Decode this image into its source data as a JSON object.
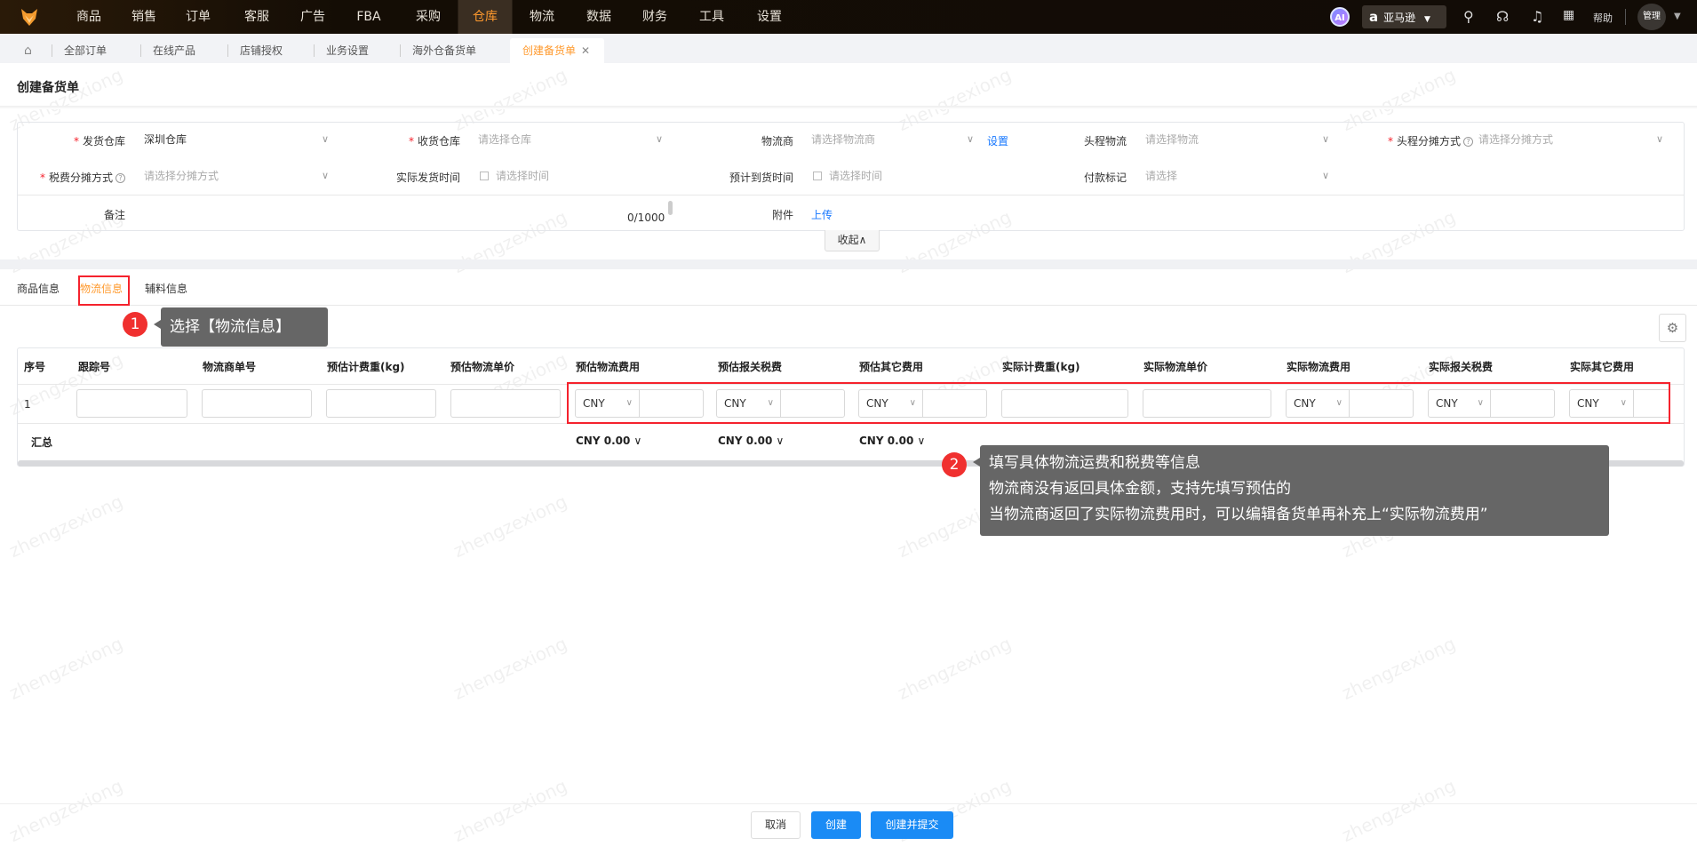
{
  "topnav": {
    "items": [
      "商品",
      "销售",
      "订单",
      "客服",
      "广告",
      "FBA",
      "采购",
      "仓库",
      "物流",
      "数据",
      "财务",
      "工具",
      "设置"
    ],
    "active_index": 7,
    "ai_label": "AI",
    "site_select": "亚马逊",
    "help": "帮助",
    "user": "管理"
  },
  "page_tabs": [
    {
      "label": "全部订单"
    },
    {
      "label": "在线产品"
    },
    {
      "label": "店铺授权"
    },
    {
      "label": "业务设置"
    },
    {
      "label": "海外仓备货单"
    },
    {
      "label": "创建备货单",
      "active": true
    }
  ],
  "page_title": "创建备货单",
  "form": {
    "ship_warehouse": {
      "label": "发货仓库",
      "value": "深圳仓库"
    },
    "recv_warehouse": {
      "label": "收货仓库",
      "placeholder": "请选择仓库"
    },
    "carrier": {
      "label": "物流商",
      "placeholder": "请选择物流商",
      "link": "设置"
    },
    "first_leg": {
      "label": "头程物流",
      "placeholder": "请选择物流"
    },
    "first_leg_alloc": {
      "label": "头程分摊方式",
      "placeholder": "请选择分摊方式"
    },
    "tax_alloc": {
      "label": "税费分摊方式",
      "placeholder": "请选择分摊方式"
    },
    "actual_ship_time": {
      "label": "实际发货时间",
      "placeholder": "请选择时间"
    },
    "eta": {
      "label": "预计到货时间",
      "placeholder": "请选择时间"
    },
    "payment_mark": {
      "label": "付款标记",
      "placeholder": "请选择"
    },
    "remark": {
      "label": "备注",
      "counter": "0/1000"
    },
    "attachment": {
      "label": "附件",
      "link": "上传"
    },
    "collapse": "收起"
  },
  "sub_tabs": [
    "商品信息",
    "物流信息",
    "辅料信息"
  ],
  "sub_tab_active": 1,
  "annotations": {
    "one": {
      "num": "1",
      "text": "选择【物流信息】"
    },
    "two": {
      "num": "2",
      "lines": [
        "填写具体物流运费和税费等信息",
        "物流商没有返回具体金额，支持先填写预估的",
        "当物流商返回了实际物流费用时，可以编辑备货单再补充上“实际物流费用”"
      ]
    }
  },
  "table": {
    "headers": [
      "序号",
      "跟踪号",
      "物流商单号",
      "预估计费重(kg)",
      "预估物流单价",
      "预估物流费用",
      "预估报关税费",
      "预估其它费用",
      "实际计费重(kg)",
      "实际物流单价",
      "实际物流费用",
      "实际报关税费",
      "实际其它费用"
    ],
    "row": {
      "index": "1",
      "currency": "CNY"
    },
    "summary": {
      "label": "汇总",
      "est_logistics": "CNY 0.00",
      "est_tax": "CNY 0.00",
      "est_other": "CNY 0.00"
    }
  },
  "footer": {
    "cancel": "取消",
    "create": "创建",
    "create_submit": "创建并提交"
  },
  "watermark": "zhengzexiong",
  "colors": {
    "accent": "#ff9a2e",
    "primary": "#1a8bf5",
    "highlight": "#f5222d"
  }
}
